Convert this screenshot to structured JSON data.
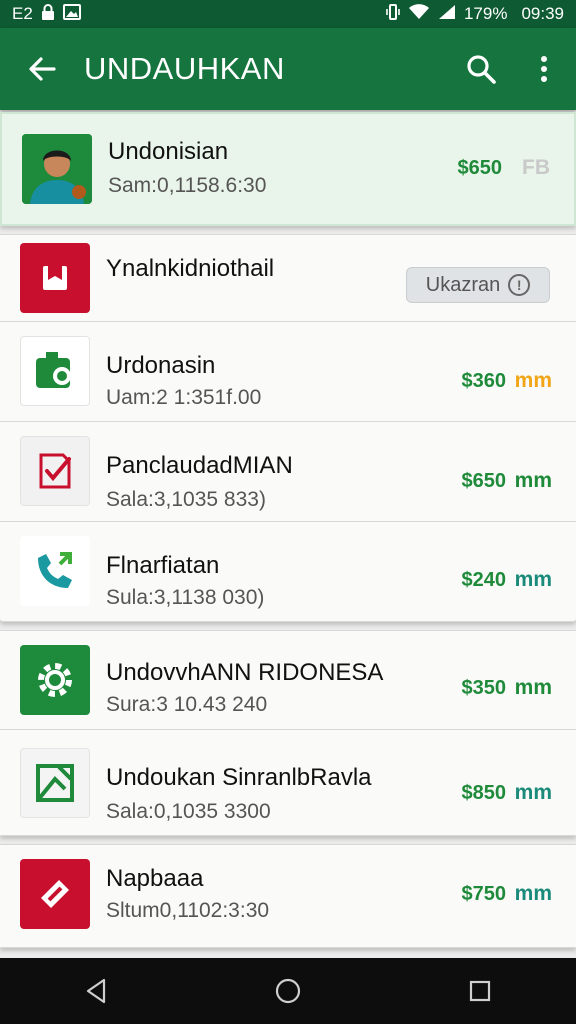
{
  "status_bar": {
    "left_text": "E2",
    "right_text": "179%",
    "time": "09:39",
    "icons": [
      "lock-icon",
      "image-icon",
      "vibrate-icon",
      "wifi-icon",
      "signal-icon"
    ]
  },
  "app_bar": {
    "title": "UNDAUHKAN",
    "back_icon": "arrow-back-icon",
    "search_icon": "search-icon",
    "menu_icon": "more-vert-icon"
  },
  "items": [
    {
      "name": "Undonisian",
      "meta": "Sam:0,1158.6:30",
      "price": "$650",
      "badge": "FB",
      "badge_color": "#c9c9c9",
      "icon": "avatar-icon",
      "icon_bg": "#1d8a3c"
    },
    {
      "name": "Ynalnkidniothail",
      "meta": "",
      "button_label": "Ukazran",
      "icon": "bookmark-icon",
      "icon_bg": "#c8102e"
    },
    {
      "name": "Urdonasin",
      "meta": "Uam:2 1:351f.00",
      "price": "$360",
      "badge": "mm",
      "badge_color": "#f2a517",
      "icon": "camera-icon",
      "icon_bg": "#ffffff"
    },
    {
      "name": "PanclaudadMIAN",
      "meta": "Sala:3,1035 833)",
      "price": "$650",
      "badge": "mm",
      "badge_color": "#1f8a3a",
      "icon": "checklist-icon",
      "icon_bg": "#ffffff"
    },
    {
      "name": "Flnarfiatan",
      "meta": "Sula:3,1138 030)",
      "price": "$240",
      "badge": "mm",
      "badge_color": "#1a8a7a",
      "icon": "phone-icon",
      "icon_bg": "#ffffff"
    },
    {
      "name": "UndovvhANN RIDONESA",
      "meta": "Sura:3 10.43 240",
      "price": "$350",
      "badge": "mm",
      "badge_color": "#1f8a3a",
      "icon": "settings-icon",
      "icon_bg": "#1d8a3c"
    },
    {
      "name": "Undoukan SinranlbRavla",
      "meta": "Sala:0,1035 3300",
      "price": "$850",
      "badge": "mm",
      "badge_color": "#1a8a7a",
      "icon": "image-edit-icon",
      "icon_bg": "#ffffff"
    },
    {
      "name": "Napbaaa",
      "meta": "Sltum0,1102:3:30",
      "price": "$750",
      "badge": "mm",
      "badge_color": "#1a8a7a",
      "icon": "tag-icon",
      "icon_bg": "#c8102e"
    }
  ],
  "nav_bar": {
    "back": "nav-back-icon",
    "home": "nav-home-icon",
    "recents": "nav-recents-icon"
  }
}
